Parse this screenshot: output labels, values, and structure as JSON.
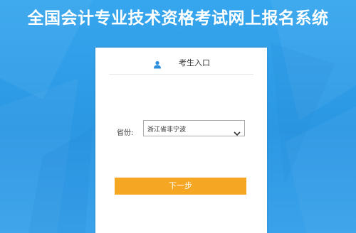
{
  "page": {
    "title": "全国会计专业技术资格考试网上报名系统"
  },
  "login_card": {
    "header_label": "考生入口",
    "province_label": "省份:",
    "province_value": "浙江省非宁波",
    "next_button_label": "下一步",
    "user_icon": "user-icon",
    "dropdown_icon": "chevron-down-icon"
  },
  "colors": {
    "background": "#2a9be8",
    "card": "#ffffff",
    "accent_icon": "#2a8ee0",
    "button": "#f5a623"
  }
}
